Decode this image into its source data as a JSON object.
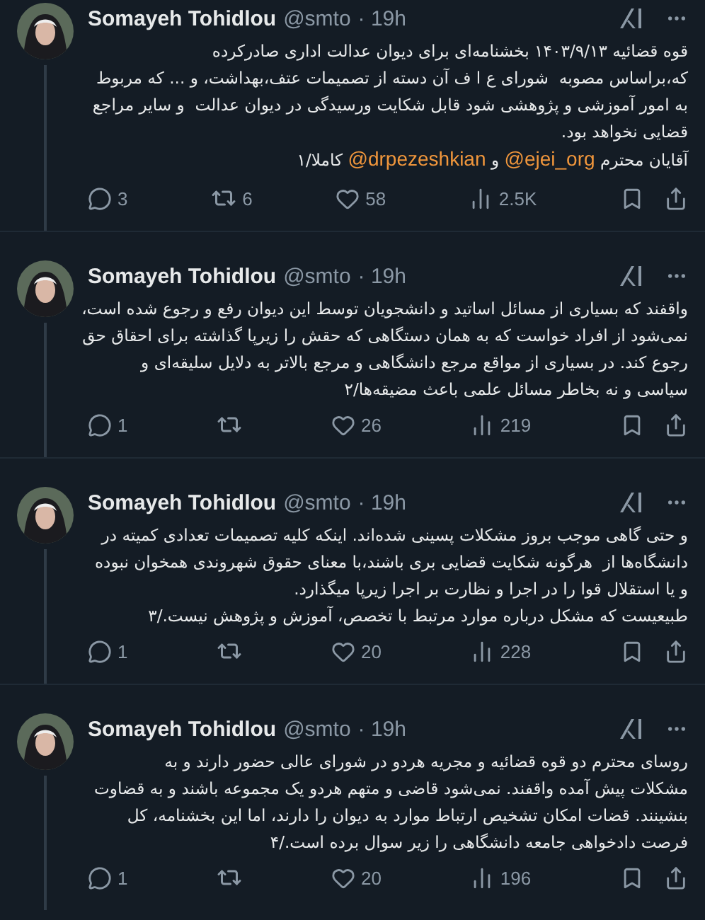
{
  "tweets": [
    {
      "name": "Somayeh Tohidlou",
      "handle": "@smto",
      "time": "· 19h",
      "text": [
        {
          "kind": "text",
          "text": "قوه قضائیه ۱۴۰۳/۹/۱۳ بخشنامه‌ای برای دیوان عدالت اداری صادرکرده\nکه،براساس مصوبه  شورای ع ا ف آن دسته از تصمیمات عتف،بهداشت، و ... که مربوط\nبه امور آموزشی و پژوهشی شود قابل شکایت ورسیدگی در دیوان عدالت  و سایر مراجع\nقضایی نخواهد بود.\nآقایان محترم "
        },
        {
          "kind": "mention",
          "text": "@ejei_org"
        },
        {
          "kind": "text",
          "text": " و "
        },
        {
          "kind": "mention",
          "text": "@drpezeshkian"
        },
        {
          "kind": "text",
          "text": " کاملا/۱"
        }
      ],
      "replies": "3",
      "reposts": "6",
      "likes": "58",
      "views": "2.5K"
    },
    {
      "name": "Somayeh Tohidlou",
      "handle": "@smto",
      "time": "· 19h",
      "text": [
        {
          "kind": "text",
          "text": "واقفند که بسیاری از مسائل اساتید و دانشجویان توسط این دیوان رفع و رجوع شده است،\nنمی‌شود از افراد خواست که به همان دستگاهی که حقش را زیرپا گذاشته برای احقاق حق\nرجوع کند. در بسیاری از مواقع مرجع دانشگاهی و مرجع بالاتر به دلایل سلیقه‌ای و\nسیاسی و نه بخاطر مسائل علمی باعث مضیقه‌ها/۲"
        }
      ],
      "replies": "1",
      "likes": "26",
      "views": "219"
    },
    {
      "name": "Somayeh Tohidlou",
      "handle": "@smto",
      "time": "· 19h",
      "text": [
        {
          "kind": "text",
          "text": "و حتی گاهی موجب بروز مشکلات پسینی شده‌اند. اینکه کلیه تصمیمات تعدادی کمیته در\nدانشگاه‌ها از  هرگونه شکایت قضایی بری باشند،با معنای حقوق شهروندی همخوان نبوده\nو یا استقلال قوا را در اجرا و نظارت بر اجرا زیرپا میگذارد.\nطبیعیست که مشکل درباره موارد مرتبط با تخصص، آموزش و پژوهش نیست./۳"
        }
      ],
      "replies": "1",
      "likes": "20",
      "views": "228"
    },
    {
      "name": "Somayeh Tohidlou",
      "handle": "@smto",
      "time": "· 19h",
      "text": [
        {
          "kind": "text",
          "text": "روسای محترم دو قوه قضائیه و مجریه هردو در شورای عالی حضور دارند و به\nمشکلات پیش آمده واقفند. نمی‌شود قاضی و متهم هردو یک مجموعه باشند و به قضاوت\nبنشینند. قضات امکان تشخیص ارتباط موارد به دیوان را دارند، اما این بخشنامه، کل\nفرصت دادخواهی جامعه دانشگاهی را زیر سوال برده است./۴"
        }
      ],
      "replies": "1",
      "likes": "20",
      "views": "196"
    }
  ]
}
